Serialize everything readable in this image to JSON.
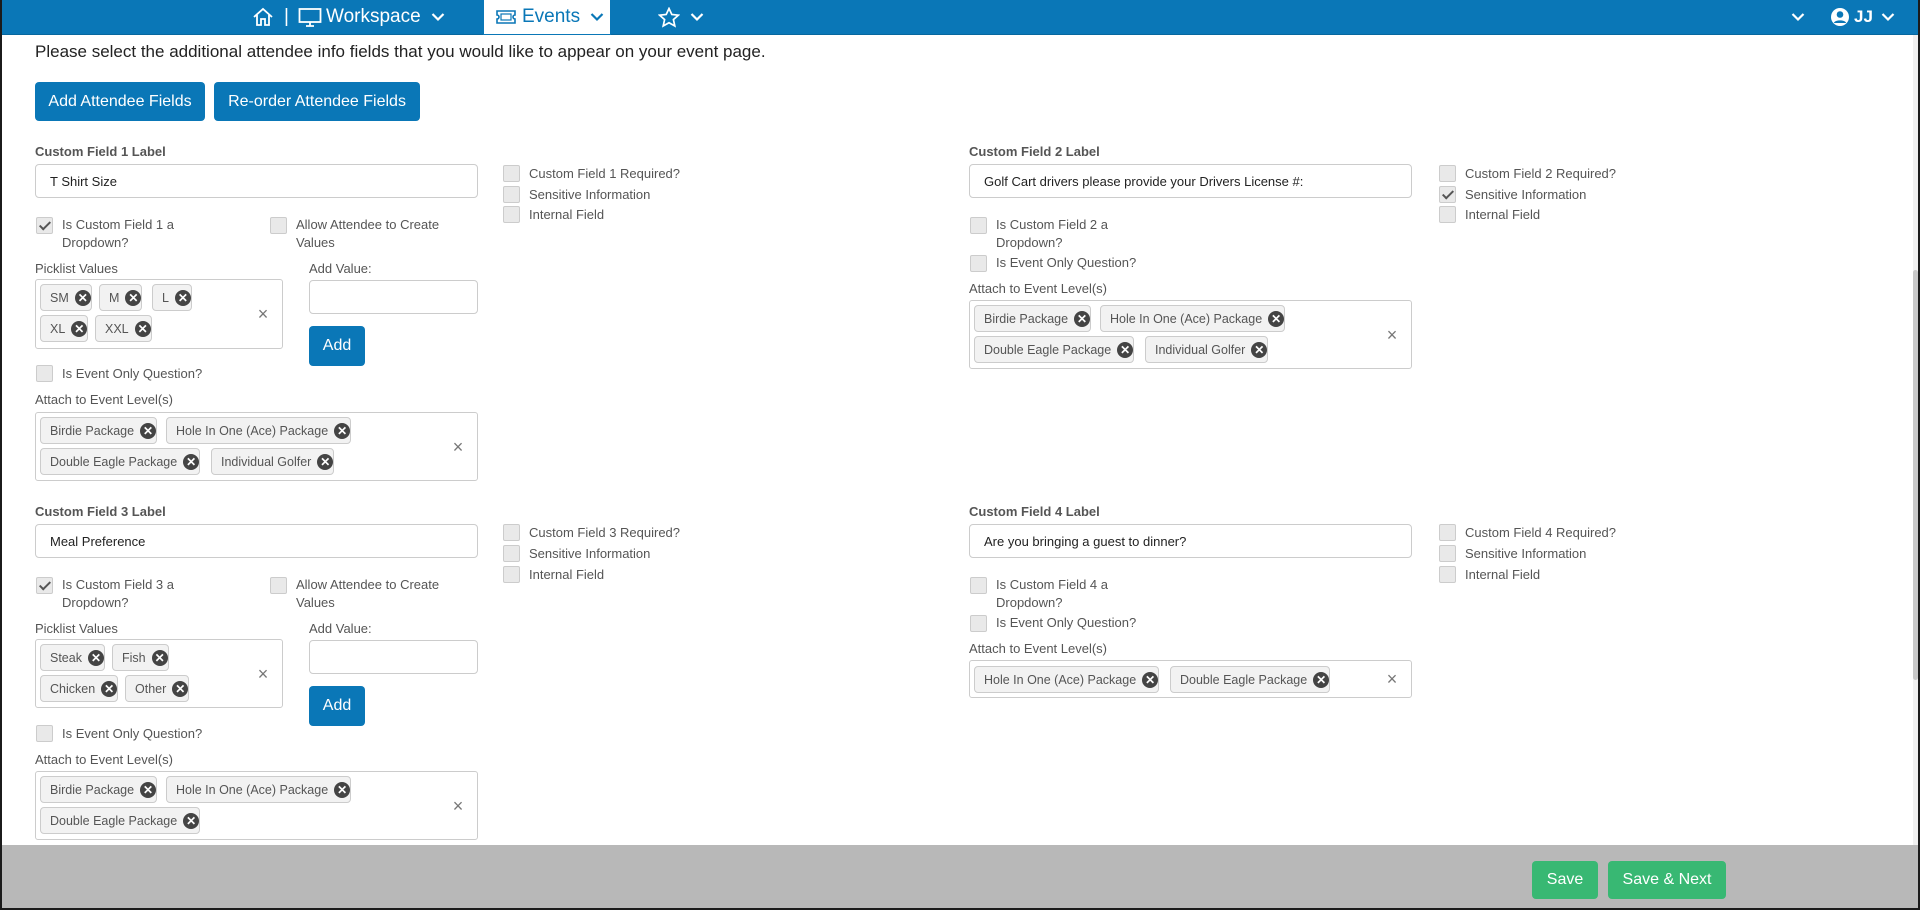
{
  "nav": {
    "workspace_label": "Workspace",
    "separator": "|",
    "events_label": "Events",
    "user_initials": "JJ",
    "accent_color": "#0a77b7"
  },
  "intro_text": "Please select the additional attendee info fields that you would like to appear on your event page.",
  "buttons": {
    "add_fields": "Add Attendee Fields",
    "reorder_fields": "Re-order Attendee Fields",
    "add": "Add",
    "save": "Save",
    "save_next": "Save & Next"
  },
  "common": {
    "sensitive": "Sensitive Information",
    "internal": "Internal Field",
    "event_only": "Is Event Only Question?",
    "attach_levels": "Attach to Event Level(s)",
    "picklist_values": "Picklist Values",
    "add_value": "Add Value:",
    "allow_create": "Allow Attendee to Create Values",
    "clear": "×",
    "remove": "✕"
  },
  "fields": [
    {
      "label_title": "Custom Field 1 Label",
      "value": "T Shirt Size",
      "required_label": "Custom Field 1 Required?",
      "required": false,
      "sensitive": false,
      "internal": false,
      "dropdown_label": "Is Custom Field 1 a Dropdown?",
      "dropdown": true,
      "allow_create": false,
      "event_only": false,
      "picklist": [
        "SM",
        "M",
        "L",
        "XL",
        "XXL"
      ],
      "levels": [
        "Birdie Package",
        "Hole In One (Ace) Package",
        "Double Eagle Package",
        "Individual Golfer"
      ]
    },
    {
      "label_title": "Custom Field 2 Label",
      "value": "Golf Cart drivers please provide your Drivers License #:",
      "required_label": "Custom Field 2 Required?",
      "required": false,
      "sensitive": true,
      "internal": false,
      "dropdown_label": "Is Custom Field 2 a Dropdown?",
      "dropdown": false,
      "event_only": false,
      "levels": [
        "Birdie Package",
        "Hole In One (Ace) Package",
        "Double Eagle Package",
        "Individual Golfer"
      ]
    },
    {
      "label_title": "Custom Field 3 Label",
      "value": "Meal Preference",
      "required_label": "Custom Field 3 Required?",
      "required": false,
      "sensitive": false,
      "internal": false,
      "dropdown_label": "Is Custom Field 3 a Dropdown?",
      "dropdown": true,
      "allow_create": false,
      "event_only": false,
      "picklist": [
        "Steak",
        "Fish",
        "Chicken",
        "Other"
      ],
      "levels": [
        "Birdie Package",
        "Hole In One (Ace) Package",
        "Double Eagle Package"
      ]
    },
    {
      "label_title": "Custom Field 4 Label",
      "value": "Are you bringing a guest to dinner?",
      "required_label": "Custom Field 4 Required?",
      "required": false,
      "sensitive": false,
      "internal": false,
      "dropdown_label": "Is Custom Field 4 a Dropdown?",
      "dropdown": false,
      "event_only": false,
      "levels": [
        "Hole In One (Ace) Package",
        "Double Eagle Package"
      ]
    }
  ]
}
